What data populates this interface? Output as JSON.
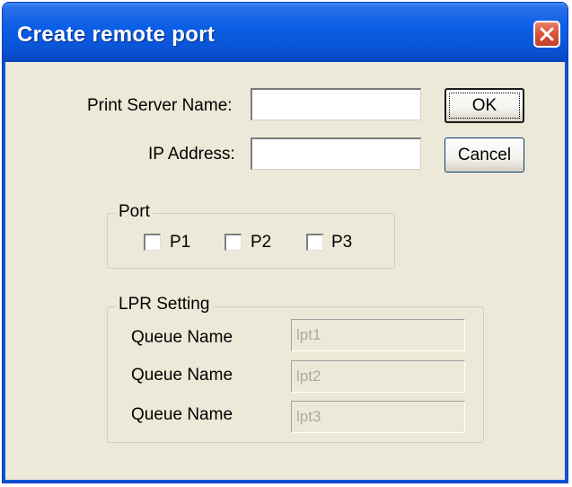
{
  "window": {
    "title": "Create remote port"
  },
  "form": {
    "print_server_name_label": "Print Server Name:",
    "print_server_name_value": "",
    "ip_address_label": "IP Address:",
    "ip_address_value": ""
  },
  "buttons": {
    "ok_label": "OK",
    "cancel_label": "Cancel"
  },
  "port_group": {
    "legend": "Port",
    "ports": [
      {
        "label": "P1",
        "checked": false
      },
      {
        "label": "P2",
        "checked": false
      },
      {
        "label": "P3",
        "checked": false
      }
    ]
  },
  "lpr_group": {
    "legend": "LPR Setting",
    "queues": [
      {
        "label": "Queue Name",
        "value": "lpt1"
      },
      {
        "label": "Queue Name",
        "value": "lpt2"
      },
      {
        "label": "Queue Name",
        "value": "lpt3"
      }
    ]
  },
  "colors": {
    "titlebar": "#0a55d8",
    "dialog_bg": "#ece9d8",
    "close_button": "#d8553a"
  },
  "icons": {
    "close": "close-icon"
  }
}
